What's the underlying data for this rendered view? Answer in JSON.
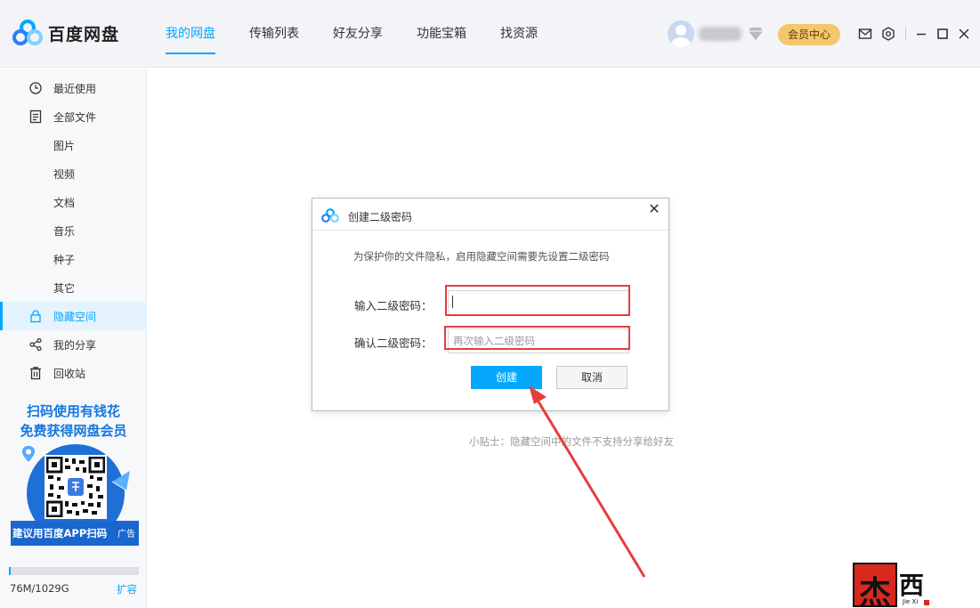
{
  "app": {
    "logo_text": "百度网盘"
  },
  "nav": {
    "items": [
      "我的网盘",
      "传输列表",
      "好友分享",
      "功能宝箱",
      "找资源"
    ],
    "active_index": 0
  },
  "header": {
    "vip_label": "会员中心",
    "icons": [
      "mail-icon",
      "settings-icon",
      "minimize-icon",
      "maximize-icon",
      "close-icon"
    ]
  },
  "sidebar": {
    "items": [
      {
        "label": "最近使用",
        "icon": "clock-icon"
      },
      {
        "label": "全部文件",
        "icon": "file-icon"
      },
      {
        "label": "图片"
      },
      {
        "label": "视频"
      },
      {
        "label": "文档"
      },
      {
        "label": "音乐"
      },
      {
        "label": "种子"
      },
      {
        "label": "其它"
      },
      {
        "label": "隐藏空间",
        "icon": "lock-icon",
        "active": true
      },
      {
        "label": "我的分享",
        "icon": "share-icon"
      },
      {
        "label": "回收站",
        "icon": "trash-icon"
      }
    ],
    "promo_line1": "扫码使用有钱花",
    "promo_line2": "免费获得网盘会员",
    "qr_caption": "建议用百度APP扫码",
    "ad_label": "广告",
    "quota_text": "76M/1029G",
    "quota_fraction": 0.0001,
    "expand_label": "扩容"
  },
  "main": {
    "tip": "小贴士：隐藏空间中的文件不支持分享给好友"
  },
  "dialog": {
    "title": "创建二级密码",
    "description": "为保护你的文件隐私，启用隐藏空间需要先设置二级密码",
    "password_label": "输入二级密码：",
    "password_value": "",
    "confirm_label": "确认二级密码：",
    "confirm_placeholder": "再次输入二级密码",
    "create_label": "创建",
    "cancel_label": "取消",
    "close_glyph": "✕"
  },
  "watermark": {
    "seal_char": "杰",
    "char": "西",
    "sub": "Jie Xi"
  },
  "colors": {
    "accent": "#06a7ff",
    "highlight": "#e53e3e",
    "vip": "#f5c76c"
  }
}
